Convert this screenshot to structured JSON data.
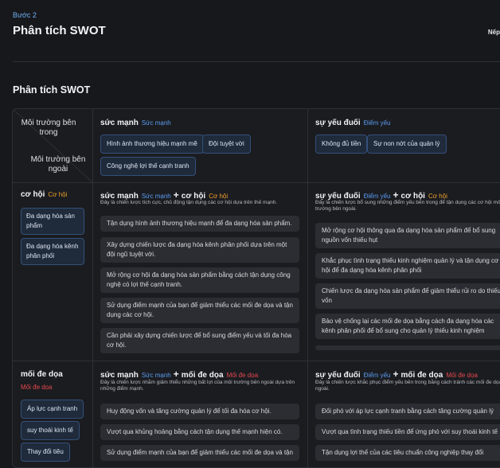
{
  "header": {
    "step": "Bước 2",
    "title": "Phân tích SWOT",
    "next": "Nếp"
  },
  "section_title": "Phân tích SWOT",
  "corner": {
    "top": "Môi trường bên trong",
    "bottom": "Môi trường bên ngoài"
  },
  "columns": {
    "strengths": {
      "title": "sức mạnh",
      "sub": "Sức mạnh",
      "chips": [
        "Hình ảnh thương hiệu mạnh mẽ",
        "Đội tuyệt vời",
        "Công nghệ lợi thế cạnh tranh"
      ]
    },
    "weaknesses": {
      "title": "sự yếu đuối",
      "sub": "Điểm yếu",
      "chips": [
        "Không đủ tiền",
        "Sự non nớt của quản lý"
      ]
    }
  },
  "rows": {
    "opportunities": {
      "title": "cơ hội",
      "sub": "Cơ hội",
      "chips": [
        "Đa dạng hóa sản phẩm",
        "Đa dạng hóa kênh phân phối"
      ]
    },
    "threats": {
      "title": "mối đe dọa",
      "sub": "Mối đe dọa",
      "chips": [
        "Áp lực cạnh tranh",
        "suy thoái kinh tế",
        "Thay đổi tiêu"
      ]
    }
  },
  "plus": "+",
  "so": {
    "a": "sức mạnh",
    "a_sub": "Sức mạnh",
    "b": "cơ hội",
    "b_sub": "Cơ hội",
    "desc": "Đây là chiến lược tích cực, chủ động tận dụng các cơ hội dựa trên thế mạnh.",
    "items": [
      "Tận dụng hình ảnh thương hiệu mạnh để đa dạng hóa sản phẩm.",
      "Xây dựng chiến lược đa dạng hóa kênh phân phối dựa trên một đội ngũ tuyệt vời.",
      "Mở rộng cơ hội đa dạng hóa sản phẩm bằng cách tận dụng công nghệ có lợi thế cạnh tranh.",
      "Sử dụng điểm mạnh của bạn để giảm thiểu các mối đe dọa và tận dụng các cơ hội.",
      "Cần phải xây dựng chiến lược để bổ sung điểm yếu và tối đa hóa cơ hội."
    ]
  },
  "wo": {
    "a": "sự yếu đuối",
    "a_sub": "Điểm yếu",
    "b": "cơ hội",
    "b_sub": "Cơ hội",
    "desc": "Đây là chiến lược bổ sung những điểm yếu bên trong để tận dụng các cơ hội môi trường bên ngoài.",
    "items": [
      "Mở rộng cơ hội thông qua đa dạng hóa sản phẩm để bổ sung nguồn vốn thiếu hụt",
      "Khắc phục tình trạng thiếu kinh nghiệm quản lý và tận dụng cơ hội để đa dạng hóa kênh phân phối",
      "Chiến lược đa dạng hóa sản phẩm để giảm thiểu rủi ro do thiếu vốn",
      "Bảo vệ chống lại các mối đe dọa bằng cách đa dạng hóa các kênh phân phối để bổ sung cho quản lý thiếu kinh nghiệm"
    ]
  },
  "st": {
    "a": "sức mạnh",
    "a_sub": "Sức mạnh",
    "b": "mối đe dọa",
    "b_sub": "Mối đe dọa",
    "desc": "Đây là chiến lược nhằm giảm thiểu những bất lợi của môi trường bên ngoài dựa trên những điểm mạnh.",
    "items": [
      "Huy động vốn và tăng cường quản lý để tối đa hóa cơ hội.",
      "Vượt qua khủng hoảng bằng cách tận dụng thế mạnh hiện có.",
      "Sử dụng điểm mạnh của bạn để giảm thiểu các mối đe dọa và tận"
    ]
  },
  "wt": {
    "a": "sự yếu đuối",
    "a_sub": "Điểm yếu",
    "b": "mối đe dọa",
    "b_sub": "Mối đe dọa",
    "desc": "Đây là chiến lược khắc phục điểm yếu bên trong bằng cách tránh các mối đe dọa bên ngoài.",
    "items": [
      "Đối phó với áp lực cạnh tranh bằng cách tăng cường quản lý",
      "Vượt qua tình trạng thiếu tiền để ứng phó với suy thoái kinh tế",
      "Tận dụng lợi thế của các tiêu chuẩn công nghiệp thay đổi"
    ]
  },
  "colors": {
    "accent_blue": "#5a9cf0",
    "accent_orange": "#f0a22c",
    "accent_red": "#e5484d",
    "bg": "#17181c"
  }
}
